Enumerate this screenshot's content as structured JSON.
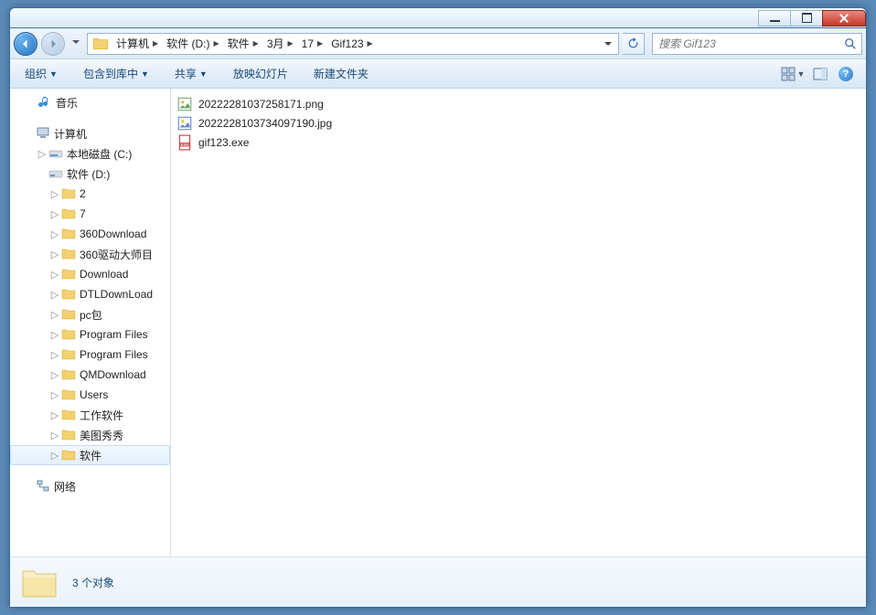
{
  "breadcrumb": {
    "items": [
      "计算机",
      "软件 (D:)",
      "软件",
      "3月",
      "17",
      "Gif123"
    ]
  },
  "search": {
    "placeholder": "搜索 Gif123"
  },
  "toolbar": {
    "organize": "组织",
    "include_lib": "包含到库中",
    "share": "共享",
    "slideshow": "放映幻灯片",
    "new_folder": "新建文件夹"
  },
  "sidebar": {
    "music": "音乐",
    "computer": "计算机",
    "localdisk_c": "本地磁盘 (C:)",
    "software_d": "软件 (D:)",
    "folders": [
      "2",
      "7",
      "360Download",
      "360驱动大师目",
      "Download",
      "DTLDownLoad",
      "pc包",
      "Program Files",
      "Program Files",
      "QMDownload",
      "Users",
      "工作软件",
      "美图秀秀",
      "软件"
    ],
    "network": "网络"
  },
  "files": {
    "items": [
      {
        "name": "20222281037258171.png",
        "type": "png"
      },
      {
        "name": "2022228103734097190.jpg",
        "type": "jpg"
      },
      {
        "name": "gif123.exe",
        "type": "exe"
      }
    ]
  },
  "details": {
    "status": "3 个对象"
  }
}
